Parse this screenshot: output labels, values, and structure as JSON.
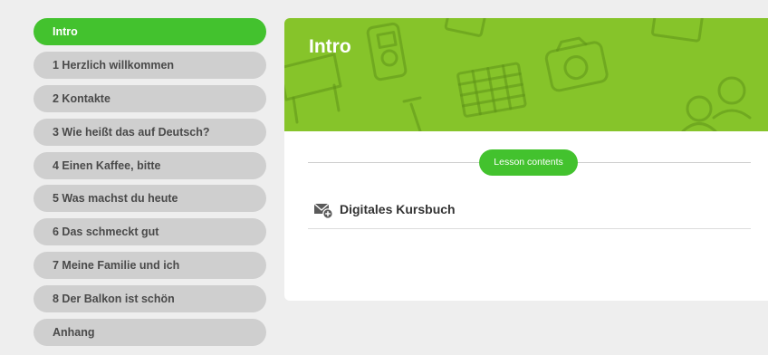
{
  "sidebar": {
    "items": [
      {
        "label": "Intro",
        "active": true
      },
      {
        "label": "1 Herzlich willkommen",
        "active": false
      },
      {
        "label": "2 Kontakte",
        "active": false
      },
      {
        "label": "3 Wie heißt das auf Deutsch?",
        "active": false
      },
      {
        "label": "4 Einen Kaffee, bitte",
        "active": false
      },
      {
        "label": "5 Was machst du heute",
        "active": false
      },
      {
        "label": "6 Das schmeckt gut",
        "active": false
      },
      {
        "label": "7 Meine Familie und ich",
        "active": false
      },
      {
        "label": "8 Der Balkon ist schön",
        "active": false
      },
      {
        "label": "Anhang",
        "active": false
      }
    ]
  },
  "main": {
    "banner_title": "Intro",
    "lesson_contents_label": "Lesson contents",
    "content_items": [
      {
        "label": "Digitales Kursbuch",
        "icon": "envelope-plus-icon"
      }
    ]
  },
  "colors": {
    "accent_green": "#43c22e",
    "banner_green": "#86c42a",
    "inactive_pill": "#cfcfcf",
    "background": "#eeeeee"
  }
}
